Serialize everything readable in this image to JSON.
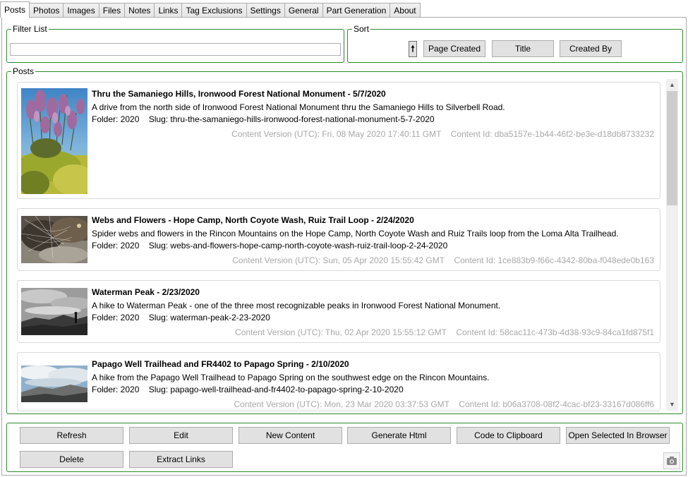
{
  "tabs": [
    "Posts",
    "Photos",
    "Images",
    "Files",
    "Notes",
    "Links",
    "Tag Exclusions",
    "Settings",
    "General",
    "Part Generation",
    "About"
  ],
  "active_tab": "Posts",
  "filter": {
    "title": "Filter List",
    "value": ""
  },
  "sort": {
    "title": "Sort",
    "direction_icon": "arrow-up-icon",
    "direction_glyph": "🠕",
    "buttons": [
      "Page Created",
      "Title",
      "Created By"
    ]
  },
  "posts_group_title": "Posts",
  "posts": [
    {
      "title": "Thru the Samaniego Hills, Ironwood Forest National Monument - 5/7/2020",
      "summary": "A drive from the north side of Ironwood Forest National Monument thru the Samaniego Hills to Silverbell Road.",
      "folder_label": "Folder: 2020",
      "slug_label": "Slug: thru-the-samaniego-hills-ironwood-forest-national-monument-5-7-2020",
      "content_version": "Content Version (UTC): Fri, 08 May 2020 17:40:11 GMT",
      "content_id": "Content Id: dba5157e-1b44-46f2-be3e-d18db8733232",
      "thumbnail": "wildflowers-photo"
    },
    {
      "title": "Webs and Flowers - Hope Camp, North Coyote Wash, Ruiz Trail Loop - 2/24/2020",
      "summary": "Spider webs and flowers in the Rincon Mountains on the Hope Camp, North Coyote Wash and Ruiz Trails loop from the Loma Alta Trailhead.",
      "folder_label": "Folder: 2020",
      "slug_label": "Slug: webs-and-flowers-hope-camp-north-coyote-wash-ruiz-trail-loop-2-24-2020",
      "content_version": "Content Version (UTC): Sun, 05 Apr 2020 15:55:42 GMT",
      "content_id": "Content Id: 1ce883b9-f66c-4342-80ba-f048ede0b163",
      "thumbnail": "spider-web-photo"
    },
    {
      "title": "Waterman Peak - 2/23/2020",
      "summary": "A hike to Waterman Peak - one of the three most recognizable peaks in Ironwood Forest National Monument.",
      "folder_label": "Folder: 2020",
      "slug_label": "Slug: waterman-peak-2-23-2020",
      "content_version": "Content Version (UTC): Thu, 02 Apr 2020 15:55:12 GMT",
      "content_id": "Content Id: 58cac11c-473b-4d38-93c9-84ca1fd875f1",
      "thumbnail": "mountain-silhouette-photo"
    },
    {
      "title": "Papago Well Trailhead and FR4402 to Papago Spring - 2/10/2020",
      "summary": "A hike from the Papago Well Trailhead to Papago Spring on the southwest edge on the Rincon Mountains.",
      "folder_label": "Folder: 2020",
      "slug_label": "Slug: papago-well-trailhead-and-fr4402-to-papago-spring-2-10-2020",
      "content_version": "Content Version (UTC): Mon, 23 Mar 2020 03:37:53 GMT",
      "content_id": "Content Id: b06a3708-08f2-4cac-bf23-33167d086ff6",
      "thumbnail": "ridge-landscape-photo"
    }
  ],
  "actions": {
    "refresh": "Refresh",
    "edit": "Edit",
    "new_content": "New Content",
    "generate_html": "Generate Html",
    "code_to_clipboard": "Code to Clipboard",
    "open_in_browser": "Open Selected In Browser",
    "delete": "Delete",
    "extract_links": "Extract Links"
  },
  "icons": {
    "scroll_up": "▲",
    "scroll_down": "▼",
    "camera": "camera-icon"
  },
  "colors": {
    "group_border": "#2d8a2d",
    "button_bg": "#e1e1e1",
    "meta_text": "#a8a8a8"
  }
}
